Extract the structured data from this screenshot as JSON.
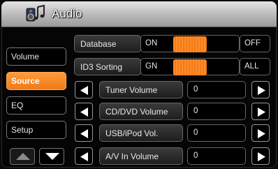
{
  "header": {
    "title": "Audio",
    "icon": "speaker-note-icon"
  },
  "sidebar": {
    "items": [
      {
        "label": "Volume",
        "active": false
      },
      {
        "label": "Source",
        "active": true
      },
      {
        "label": "EQ",
        "active": false
      },
      {
        "label": "Setup",
        "active": false
      }
    ],
    "page_up_icon": "triangle-up-icon",
    "page_down_icon": "triangle-down-icon"
  },
  "settings": {
    "database": {
      "label": "Database",
      "option_left": "ON",
      "option_right": "OFF"
    },
    "id3": {
      "label": "ID3 Sorting",
      "option_left": "GN",
      "option_right": "ALL"
    }
  },
  "volumes": [
    {
      "label": "Tuner Volume",
      "value": "0"
    },
    {
      "label": "CD/DVD Volume",
      "value": "0"
    },
    {
      "label": "USB/iPod Vol.",
      "value": "0"
    },
    {
      "label": "A/V In Volume",
      "value": "0"
    }
  ],
  "colors": {
    "accent": "#f58220",
    "background": "#000000",
    "header": "#b8b8b8"
  }
}
